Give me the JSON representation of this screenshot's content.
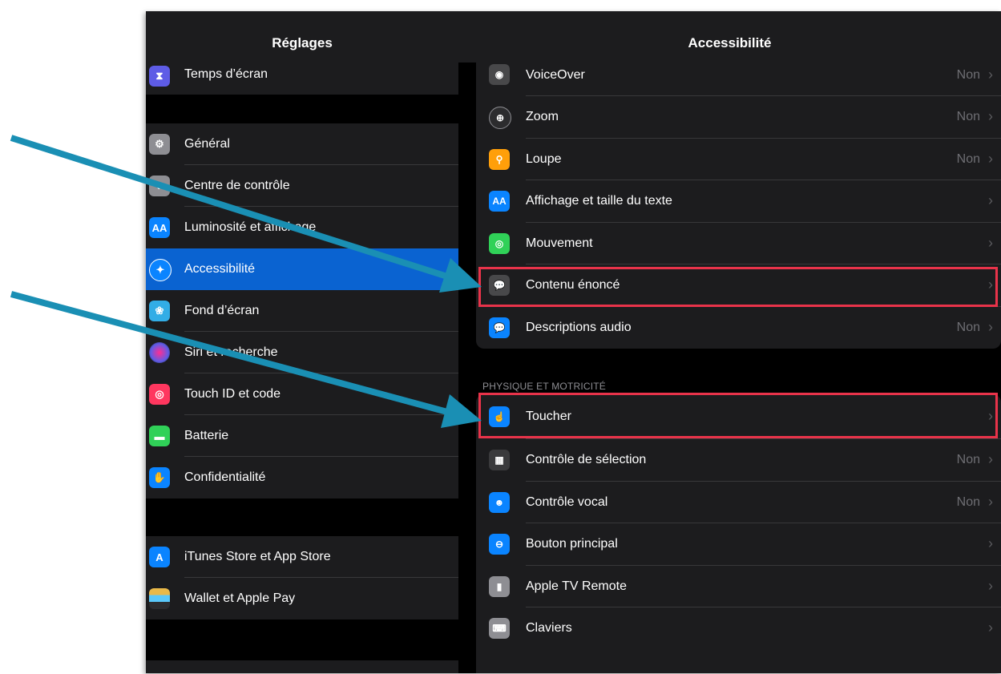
{
  "sidebar": {
    "title": "Réglages",
    "items": [
      {
        "label": "Temps d’écran",
        "icon": "hourglass-icon",
        "color": "#5e5ce6"
      },
      {
        "label": "Général",
        "icon": "gear-icon",
        "color": "#8e8e93"
      },
      {
        "label": "Centre de contrôle",
        "icon": "toggle-icon",
        "color": "#8e8e93"
      },
      {
        "label": "Luminosité et affichage",
        "icon": "text-size-icon",
        "color": "#0a84ff"
      },
      {
        "label": "Accessibilité",
        "icon": "accessibility-icon",
        "color": "#0a84ff",
        "selected": true
      },
      {
        "label": "Fond d’écran",
        "icon": "flower-icon",
        "color": "#32ade6"
      },
      {
        "label": "Siri et recherche",
        "icon": "siri-icon",
        "color": "#2c2c2e"
      },
      {
        "label": "Touch ID et code",
        "icon": "fingerprint-icon",
        "color": "#ff375f"
      },
      {
        "label": "Batterie",
        "icon": "battery-icon",
        "color": "#30d158"
      },
      {
        "label": "Confidentialité",
        "icon": "hand-icon",
        "color": "#0a84ff"
      },
      {
        "label": "iTunes Store et App Store",
        "icon": "app-store-icon",
        "color": "#0a84ff"
      },
      {
        "label": "Wallet et Apple Pay",
        "icon": "wallet-icon",
        "color": "#2c2c2e"
      }
    ]
  },
  "detail": {
    "title": "Accessibilité",
    "vision_rows": [
      {
        "label": "VoiceOver",
        "value": "Non",
        "icon": "voiceover-icon",
        "color": "#48484a"
      },
      {
        "label": "Zoom",
        "value": "Non",
        "icon": "zoom-icon",
        "color": "#2c2c2e"
      },
      {
        "label": "Loupe",
        "value": "Non",
        "icon": "magnifier-icon",
        "color": "#ff9f0a"
      },
      {
        "label": "Affichage et taille du texte",
        "value": "",
        "icon": "text-size-icon",
        "color": "#0a84ff"
      },
      {
        "label": "Mouvement",
        "value": "",
        "icon": "motion-icon",
        "color": "#30d158"
      },
      {
        "label": "Contenu énoncé",
        "value": "",
        "icon": "speech-icon",
        "color": "#48484a"
      },
      {
        "label": "Descriptions audio",
        "value": "Non",
        "icon": "audio-description-icon",
        "color": "#0a84ff"
      }
    ],
    "section_header": "PHYSIQUE ET MOTRICITÉ",
    "physical_rows": [
      {
        "label": "Toucher",
        "value": "",
        "icon": "touch-icon",
        "color": "#0a84ff"
      },
      {
        "label": "Contrôle de sélection",
        "value": "Non",
        "icon": "switch-control-icon",
        "color": "#3a3a3c"
      },
      {
        "label": "Contrôle vocal",
        "value": "Non",
        "icon": "voice-control-icon",
        "color": "#0a84ff"
      },
      {
        "label": "Bouton principal",
        "value": "",
        "icon": "home-button-icon",
        "color": "#0a84ff"
      },
      {
        "label": "Apple TV Remote",
        "value": "",
        "icon": "remote-icon",
        "color": "#8e8e93"
      },
      {
        "label": "Claviers",
        "value": "",
        "icon": "keyboard-icon",
        "color": "#8e8e93"
      }
    ]
  },
  "annotations": {
    "highlight_color": "#e8334a",
    "arrow_color": "#1a8fb4"
  }
}
